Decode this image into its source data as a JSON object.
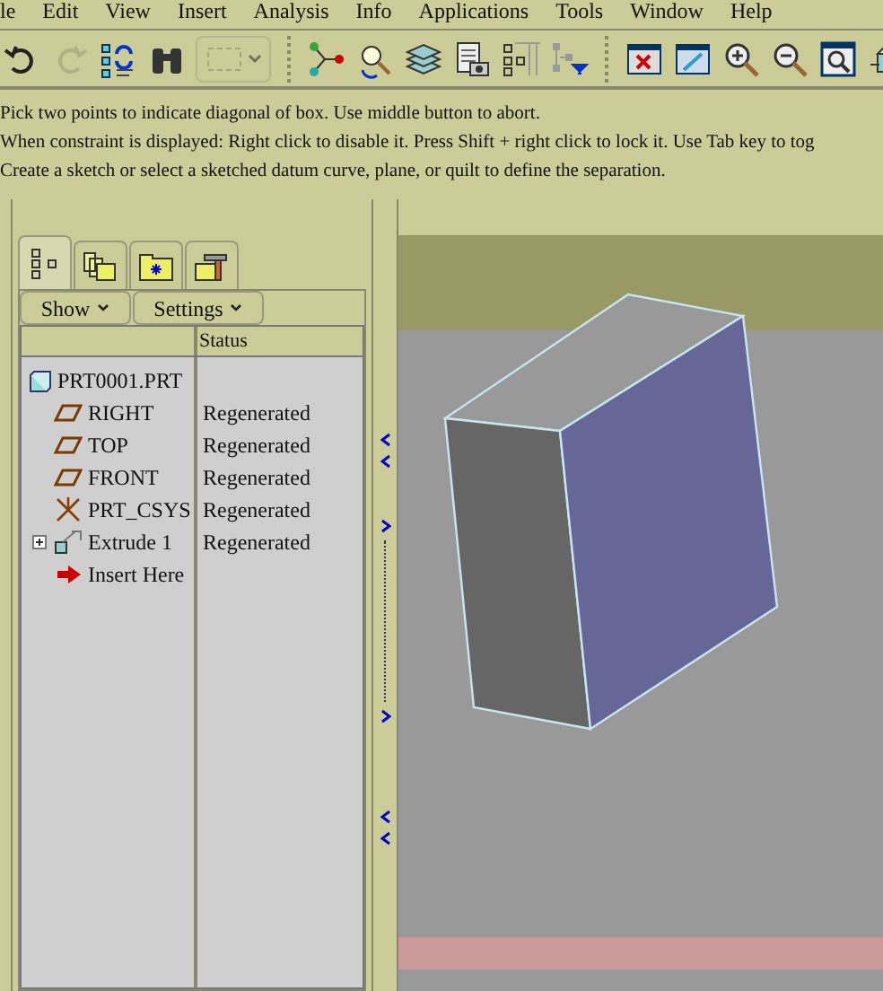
{
  "menu": [
    "le",
    "Edit",
    "View",
    "Insert",
    "Analysis",
    "Info",
    "Applications",
    "Tools",
    "Window",
    "Help"
  ],
  "toolbar": [
    {
      "kind": "undo",
      "disabled": false
    },
    {
      "kind": "redo",
      "disabled": true
    },
    {
      "kind": "regenerate",
      "disabled": false
    },
    {
      "kind": "find",
      "disabled": false
    },
    {
      "kind": "select",
      "disabled": true
    },
    {
      "kind": "sep"
    },
    {
      "kind": "datum",
      "disabled": false
    },
    {
      "kind": "analysis",
      "disabled": false
    },
    {
      "kind": "layers",
      "disabled": false
    },
    {
      "kind": "snapshot",
      "disabled": false
    },
    {
      "kind": "tree",
      "disabled": false
    },
    {
      "kind": "filter",
      "disabled": false
    },
    {
      "kind": "sep"
    },
    {
      "kind": "close",
      "disabled": false
    },
    {
      "kind": "repaint",
      "disabled": false
    },
    {
      "kind": "zoomin",
      "disabled": false
    },
    {
      "kind": "zoomout",
      "disabled": false
    },
    {
      "kind": "refit",
      "disabled": false
    },
    {
      "kind": "orient",
      "disabled": false
    }
  ],
  "messages": [
    "Pick two points to indicate diagonal of box. Use middle button to abort.",
    "When constraint is displayed: Right click to disable it. Press Shift + right click to lock it. Use Tab key to tog",
    "Create a sketch or select a sketched datum curve, plane, or quilt to define the separation."
  ],
  "tabs": [
    {
      "kind": "tree",
      "selected": true
    },
    {
      "kind": "folders",
      "selected": false
    },
    {
      "kind": "favorites",
      "selected": false
    },
    {
      "kind": "tools",
      "selected": false
    }
  ],
  "buttons": [
    "Show",
    "Settings"
  ],
  "columns": {
    "status": "Status"
  },
  "tree": {
    "name": "PRT0001.PRT",
    "children": [
      {
        "kind": "plane",
        "name": "RIGHT",
        "status": "Regenerated"
      },
      {
        "kind": "plane",
        "name": "TOP",
        "status": "Regenerated"
      },
      {
        "kind": "plane",
        "name": "FRONT",
        "status": "Regenerated"
      },
      {
        "kind": "csys",
        "name": "PRT_CSYS",
        "status": "Regenerated"
      },
      {
        "kind": "extrude",
        "name": "Extrude 1",
        "status": "Regenerated",
        "expanded": false
      },
      {
        "kind": "insert",
        "name": "Insert Here"
      }
    ]
  }
}
